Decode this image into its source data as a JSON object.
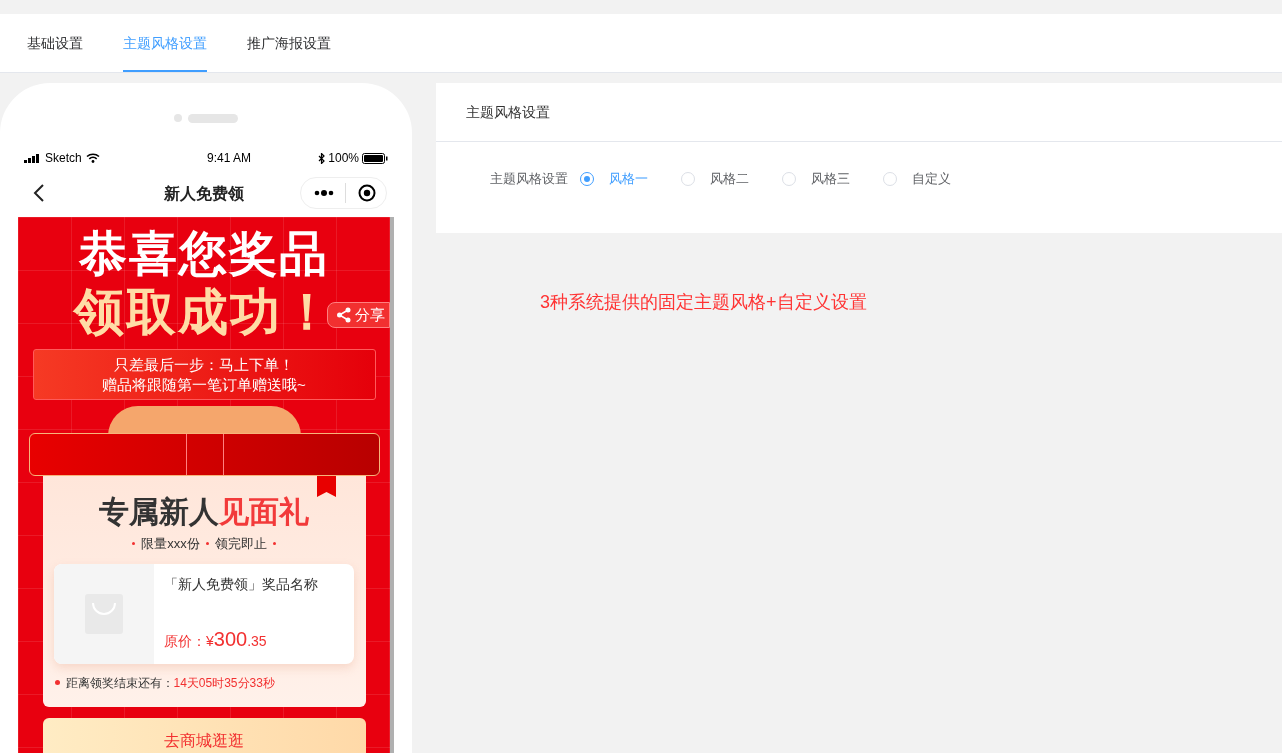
{
  "tabs": [
    {
      "label": "基础设置",
      "selected": false
    },
    {
      "label": "主题风格设置",
      "selected": true
    },
    {
      "label": "推广海报设置",
      "selected": false
    }
  ],
  "phone": {
    "status_bar": {
      "carrier": "Sketch",
      "time": "9:41 AM",
      "battery": "100%"
    },
    "nav": {
      "title": "新人免费领"
    },
    "banner": {
      "title_line_1": "恭喜您奖品",
      "title_line_2": "领取成功！",
      "share": "分享",
      "notice_lines": [
        "只差最后一步：马上下单！",
        "赠品将跟随第一笔订单赠送哦~"
      ]
    },
    "gift_card": {
      "heading": "专属新人",
      "heading_highlight": "见面礼",
      "subtitle_parts": [
        "限量xxx份",
        "领完即止"
      ],
      "product": {
        "name": "「新人免费领」奖品名称",
        "price_label": "原价：",
        "currency": "¥",
        "price_integer": "300",
        "price_decimal": ".35"
      },
      "countdown_label": "距离领奖结束还有：",
      "countdown": "14天05时35分33秒"
    },
    "mall_button": "去商城逛逛"
  },
  "settings_panel": {
    "title": "主题风格设置",
    "field_label": "主题风格设置",
    "options": [
      {
        "label": "风格一",
        "selected": true
      },
      {
        "label": "风格二",
        "selected": false
      },
      {
        "label": "风格三",
        "selected": false
      },
      {
        "label": "自定义",
        "selected": false
      }
    ]
  },
  "annotation": "3种系统提供的固定主题风格+自定义设置"
}
